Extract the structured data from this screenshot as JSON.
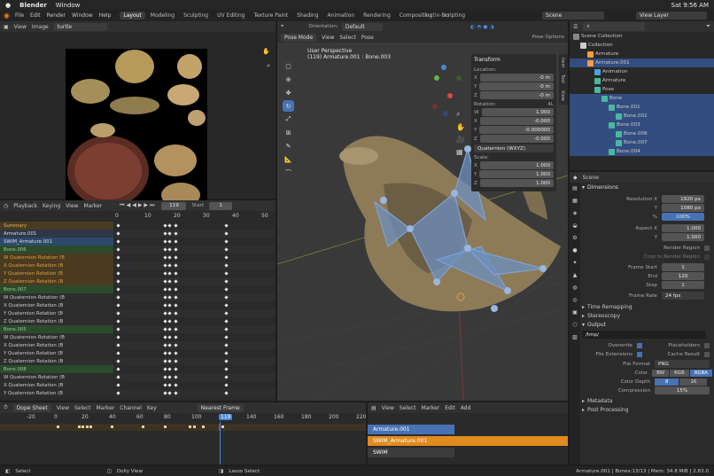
{
  "mac": {
    "app": "Blender",
    "window": "Window",
    "time": "Sat 9:56 AM"
  },
  "blender": {
    "file": "turtle-res",
    "menus": [
      "File",
      "Edit",
      "Render",
      "Window",
      "Help"
    ],
    "workspaces": [
      "Layout",
      "Modeling",
      "Sculpting",
      "UV Editing",
      "Texture Paint",
      "Shading",
      "Animation",
      "Rendering",
      "Compositing",
      "Scripting"
    ],
    "scene": "Scene",
    "view_layer": "View Layer"
  },
  "image_editor": {
    "view": "View",
    "image": "Image",
    "name": "turtle"
  },
  "viewport": {
    "mode": "Pose Mode",
    "view": "View",
    "select": "Select",
    "pose": "Pose",
    "orientation_label": "Orientation:",
    "orientation": "Default",
    "pose_options": "Pose Options",
    "info1": "User Perspective",
    "info2": "(119) Armature.001 : Bone.003",
    "tabs": [
      "Item",
      "Tool",
      "View"
    ]
  },
  "transform": {
    "title": "Transform",
    "location": "Location:",
    "loc": [
      {
        "a": "X",
        "v": "-0 m"
      },
      {
        "a": "Y",
        "v": "-0 m"
      },
      {
        "a": "Z",
        "v": "-0 m"
      }
    ],
    "rotation": "Rotation:",
    "rot_mode": "4L",
    "rot": [
      {
        "a": "W",
        "v": "1.000"
      },
      {
        "a": "X",
        "v": "-0.000"
      },
      {
        "a": "Y",
        "v": "-0.000000"
      },
      {
        "a": "Z",
        "v": "-0.000"
      }
    ],
    "quat": "Quaternion (WXYZ)",
    "scale": "Scale:",
    "scl": [
      {
        "a": "X",
        "v": "1.000"
      },
      {
        "a": "Y",
        "v": "1.000"
      },
      {
        "a": "Z",
        "v": "1.000"
      }
    ]
  },
  "dopesheet_top": {
    "playback": "Playback",
    "keying": "Keying",
    "view": "View",
    "marker": "Marker",
    "frame": "119",
    "start_label": "Start",
    "start": "1",
    "ticks": [
      "0",
      "10",
      "20",
      "30",
      "40",
      "50"
    ],
    "channels": [
      {
        "t": "Summary",
        "k": "summary"
      },
      {
        "t": "Armature.001",
        "k": "obj"
      },
      {
        "t": "SWIM_Armature.001",
        "k": "action"
      },
      {
        "t": "Bone.006",
        "k": "group"
      },
      {
        "t": "W Quaternion Rotation (B",
        "k": "fc"
      },
      {
        "t": "X Quaternion Rotation (B",
        "k": "fc"
      },
      {
        "t": "Y Quaternion Rotation (B",
        "k": "fc"
      },
      {
        "t": "Z Quaternion Rotation (B",
        "k": "fc"
      },
      {
        "t": "Bone.007",
        "k": "group"
      },
      {
        "t": "W Quaternion Rotation (B",
        "k": "fc2"
      },
      {
        "t": "X Quaternion Rotation (B",
        "k": "fc2"
      },
      {
        "t": "Y Quaternion Rotation (B",
        "k": "fc2"
      },
      {
        "t": "Z Quaternion Rotation (B",
        "k": "fc2"
      },
      {
        "t": "Bone.005",
        "k": "group"
      },
      {
        "t": "W Quaternion Rotation (B",
        "k": "fc2"
      },
      {
        "t": "X Quaternion Rotation (B",
        "k": "fc2"
      },
      {
        "t": "Y Quaternion Rotation (B",
        "k": "fc2"
      },
      {
        "t": "Z Quaternion Rotation (B",
        "k": "fc2"
      },
      {
        "t": "Bone.008",
        "k": "group"
      },
      {
        "t": "W Quaternion Rotation (B",
        "k": "fc2"
      },
      {
        "t": "X Quaternion Rotation (B",
        "k": "fc2"
      },
      {
        "t": "Y Quaternion Rotation (B",
        "k": "fc2"
      }
    ]
  },
  "dopesheet_bottom": {
    "mode": "Dope Sheet",
    "view": "View",
    "select": "Select",
    "marker": "Marker",
    "channel": "Channel",
    "key": "Key",
    "frame_mode": "Nearest Frame",
    "ticks": [
      "-20",
      "0",
      "20",
      "40",
      "60",
      "80",
      "100",
      "119",
      "140",
      "160",
      "180",
      "200",
      "220"
    ]
  },
  "nla": {
    "view": "View",
    "select": "Select",
    "marker": "Marker",
    "edit": "Edit",
    "add": "Add",
    "tracks": [
      "Armature.001",
      "SWIM_Armature.001",
      "SWIM"
    ]
  },
  "outliner": {
    "items": [
      {
        "t": "Scene Collection",
        "d": 0,
        "sel": false,
        "c": "#888"
      },
      {
        "t": "Collection",
        "d": 1,
        "sel": false,
        "c": "#ccc"
      },
      {
        "t": "Armature",
        "d": 2,
        "sel": false,
        "c": "#ff9b3a"
      },
      {
        "t": "Armature.001",
        "d": 2,
        "sel": true,
        "c": "#ff9b3a"
      },
      {
        "t": "Animation",
        "d": 3,
        "sel": false,
        "c": "#4aa1d9"
      },
      {
        "t": "Armature",
        "d": 3,
        "sel": false,
        "c": "#4ab8a0"
      },
      {
        "t": "Pose",
        "d": 3,
        "sel": false,
        "c": "#4ab8a0"
      },
      {
        "t": "Bone",
        "d": 4,
        "sel": true,
        "c": "#4ab8a0"
      },
      {
        "t": "Bone.001",
        "d": 5,
        "sel": true,
        "c": "#4ab8a0"
      },
      {
        "t": "Bone.002",
        "d": 6,
        "sel": true,
        "c": "#4ab8a0"
      },
      {
        "t": "Bone.003",
        "d": 5,
        "sel": true,
        "c": "#4ab8a0"
      },
      {
        "t": "Bone.006",
        "d": 6,
        "sel": true,
        "c": "#4ab8a0"
      },
      {
        "t": "Bone.007",
        "d": 6,
        "sel": true,
        "c": "#4ab8a0"
      },
      {
        "t": "Bone.004",
        "d": 5,
        "sel": true,
        "c": "#4ab8a0"
      }
    ]
  },
  "props": {
    "scene": "Scene",
    "dimensions": "Dimensions",
    "res_x_label": "Resolution X",
    "res_x": "1920 px",
    "y_label": "Y",
    "res_y": "1080 px",
    "pct_label": "%",
    "pct": "100%",
    "aspect_x_label": "Aspect X",
    "aspect_x": "1.000",
    "aspect_y": "1.000",
    "render_region": "Render Region",
    "crop": "Crop to Render Region",
    "frame_start_label": "Frame Start",
    "frame_start": "1",
    "end_label": "End",
    "end": "120",
    "step_label": "Step",
    "step": "1",
    "frame_rate_label": "Frame Rate",
    "frame_rate": "24 fps",
    "time_remap": "Time Remapping",
    "stereo": "Stereoscopy",
    "output": "Output",
    "path": "/tmp/",
    "overwrite": "Overwrite",
    "placeholders": "Placeholders",
    "file_ext": "File Extensions",
    "cache": "Cache Result",
    "format_label": "File Format",
    "format": "PNG",
    "color_label": "Color",
    "colors": [
      "BW",
      "RGB",
      "RGBA"
    ],
    "depth_label": "Color Depth",
    "depths": [
      "8",
      "16"
    ],
    "compression_label": "Compression",
    "compression": "15%",
    "metadata": "Metadata",
    "post": "Post Processing"
  },
  "status": {
    "select": "Select",
    "dolly": "Dolly View",
    "lasso": "Lasso Select",
    "info": "Armature.001 | Bones:13/13 | Mem: 34.8 MiB | 2.83.0"
  }
}
